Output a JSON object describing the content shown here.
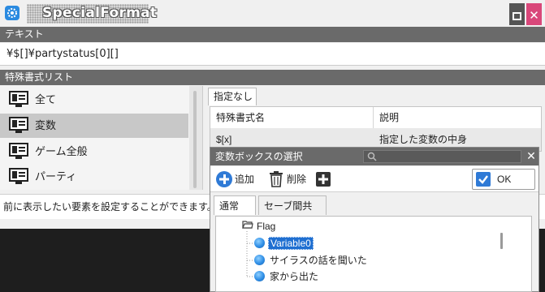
{
  "window": {
    "title": "SpecialFormat",
    "maximize_label": "",
    "close_label": "✕"
  },
  "text_section": {
    "header": "テキスト",
    "value": "¥$[]¥partystatus[0][]"
  },
  "format_list": {
    "header": "特殊書式リスト",
    "items": [
      {
        "label": "全て",
        "selected": false
      },
      {
        "label": "変数",
        "selected": true
      },
      {
        "label": "ゲーム全般",
        "selected": false
      },
      {
        "label": "パーティ",
        "selected": false
      }
    ]
  },
  "right_panel": {
    "tab_label": "指定なし",
    "columns": [
      "特殊書式名",
      "説明"
    ],
    "rows": [
      {
        "name": "$[x]",
        "description": "指定した変数の中身"
      }
    ]
  },
  "status_text": "前に表示したい要素を設定することができます。特殊",
  "popup": {
    "title": "変数ボックスの選択",
    "search_placeholder": "",
    "close_label": "✕",
    "toolbar": {
      "add_label": "追加",
      "delete_label": "削除",
      "ok_label": "OK"
    },
    "tabs": [
      {
        "label": "通常",
        "active": true
      },
      {
        "label": "セーブ間共有",
        "active": false
      }
    ],
    "tree": {
      "folder_label": "Flag",
      "items": [
        {
          "label": "Variable0",
          "selected": true
        },
        {
          "label": "サイラスの話を聞いた",
          "selected": false
        },
        {
          "label": "家から出た",
          "selected": false
        }
      ]
    }
  },
  "colors": {
    "header_gray": "#6a6a6a",
    "selection_blue": "#1f6fd1",
    "close_pink": "#d9477a",
    "accent_blue": "#2a8ae0"
  }
}
